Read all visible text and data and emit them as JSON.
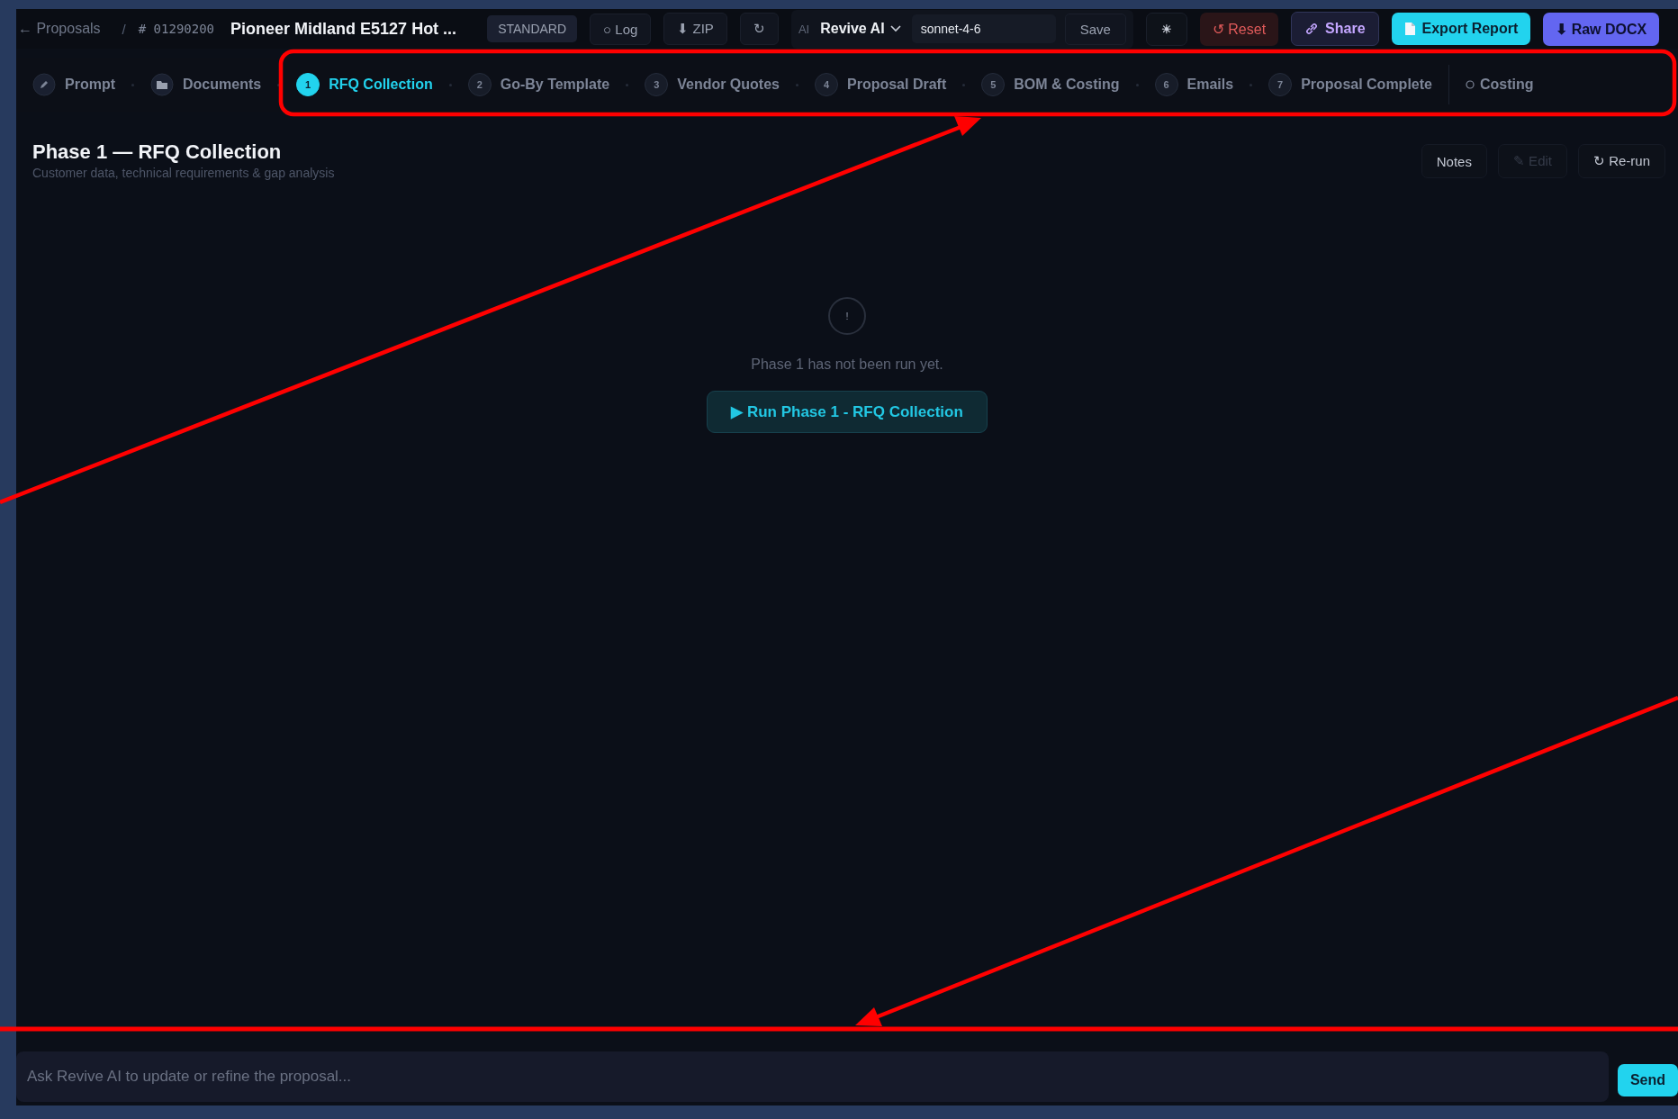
{
  "topbar": {
    "back": "← Proposals",
    "separator": "/",
    "proposal_id": "# 01290200",
    "title": "Pioneer Midland E5127 Hot ...",
    "items": [
      {
        "kind": "badge",
        "label": "STANDARD"
      },
      {
        "kind": "button",
        "label": "○ Log"
      },
      {
        "kind": "button",
        "label": "⬇ ZIP"
      },
      {
        "kind": "button",
        "label": "↻"
      }
    ],
    "ai": {
      "label": "AI",
      "provider": "Revive AI",
      "model": "sonnet-4-6",
      "save": "Save"
    },
    "actions": [
      {
        "kind": "theme",
        "label": "☀"
      },
      {
        "kind": "danger",
        "label": "↺ Reset"
      },
      {
        "kind": "share",
        "label": "Share"
      },
      {
        "kind": "primary",
        "label": "Export Report"
      },
      {
        "kind": "accent",
        "label": "⬇ Raw DOCX"
      }
    ]
  },
  "tabs": [
    {
      "kind": "pencil",
      "label": "Prompt",
      "selected": false
    },
    {
      "kind": "folder",
      "label": "Documents",
      "selected": false
    },
    {
      "kind": "numbered",
      "number": "1",
      "label": "RFQ Collection",
      "selected": true
    },
    {
      "kind": "numbered",
      "number": "2",
      "label": "Go-By Template",
      "selected": false
    },
    {
      "kind": "numbered",
      "number": "3",
      "label": "Vendor Quotes",
      "selected": false
    },
    {
      "kind": "numbered",
      "number": "4",
      "label": "Proposal Draft",
      "selected": false
    },
    {
      "kind": "numbered",
      "number": "5",
      "label": "BOM & Costing",
      "selected": false
    },
    {
      "kind": "numbered",
      "number": "6",
      "label": "Emails",
      "selected": false
    },
    {
      "kind": "numbered",
      "number": "7",
      "label": "Proposal Complete",
      "selected": false
    },
    {
      "kind": "circle",
      "label": "Costing",
      "selected": false
    }
  ],
  "phase": {
    "title": "Phase 1 — RFQ Collection",
    "subtitle": "Customer data, technical requirements & gap analysis",
    "buttons": [
      {
        "label": "Notes",
        "disabled": false
      },
      {
        "label": "✎ Edit",
        "disabled": true
      },
      {
        "label": "↻ Re-run",
        "disabled": false
      }
    ]
  },
  "empty_state": {
    "icon_mark": "!",
    "message": "Phase 1 has not been run yet.",
    "run_button": "▶ Run Phase 1 - RFQ Collection"
  },
  "chat": {
    "placeholder": "Ask Revive AI to update or refine the proposal...",
    "send": "Send"
  },
  "annotations": [
    {
      "kind": "box"
    },
    {
      "kind": "arrow"
    },
    {
      "kind": "arrow"
    },
    {
      "kind": "line"
    }
  ]
}
